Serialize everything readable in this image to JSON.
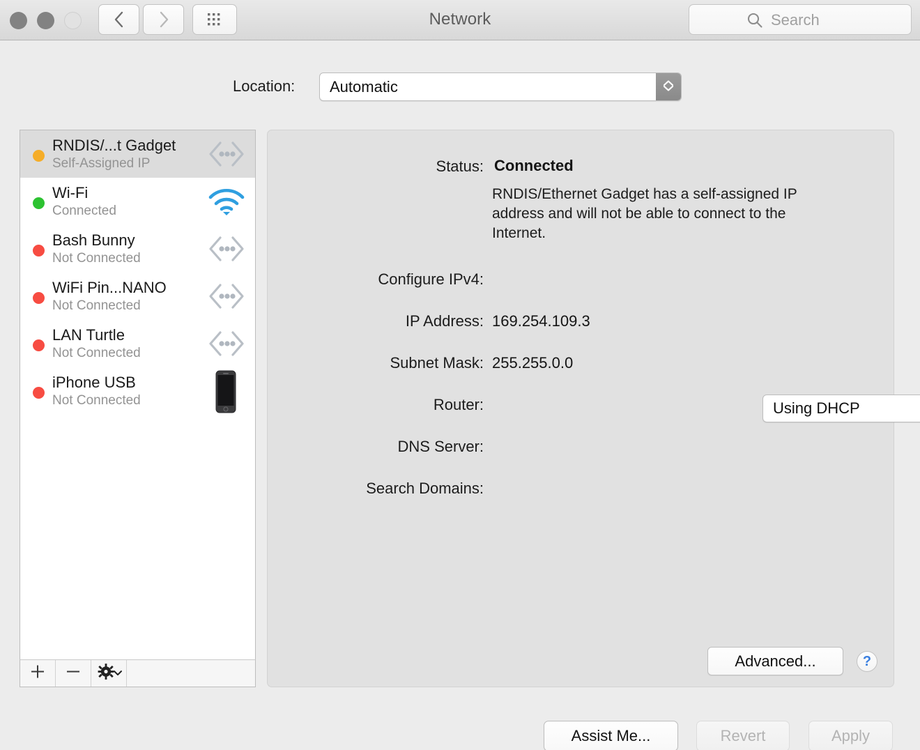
{
  "window": {
    "title": "Network",
    "traffic_lights": [
      "close",
      "minimize",
      "zoom"
    ]
  },
  "toolbar": {
    "back_icon": "chevron-left-icon",
    "forward_icon": "chevron-right-icon",
    "grid_icon": "show-all-grid-icon",
    "search": {
      "placeholder": "Search",
      "icon": "search-icon"
    }
  },
  "location": {
    "label": "Location:",
    "value": "Automatic"
  },
  "services": [
    {
      "name": "RNDIS/...t Gadget",
      "status": "Self-Assigned IP",
      "dot_color": "#f5ad28",
      "icon": "serial-ethernet-icon",
      "selected": true
    },
    {
      "name": "Wi-Fi",
      "status": "Connected",
      "dot_color": "#2cc231",
      "icon": "wifi-icon",
      "selected": false
    },
    {
      "name": "Bash Bunny",
      "status": "Not Connected",
      "dot_color": "#f74c42",
      "icon": "serial-ethernet-icon",
      "selected": false
    },
    {
      "name": "WiFi Pin...NANO",
      "status": "Not Connected",
      "dot_color": "#f74c42",
      "icon": "serial-ethernet-icon",
      "selected": false
    },
    {
      "name": "LAN Turtle",
      "status": "Not Connected",
      "dot_color": "#f74c42",
      "icon": "serial-ethernet-icon",
      "selected": false
    },
    {
      "name": "iPhone USB",
      "status": "Not Connected",
      "dot_color": "#f74c42",
      "icon": "iphone-icon",
      "selected": false
    }
  ],
  "list_toolbar": {
    "add_label": "+",
    "remove_label": "−",
    "action_icon": "gear-icon",
    "action_chevron": "chevron-down-icon"
  },
  "detail": {
    "status_label": "Status:",
    "status_value": "Connected",
    "status_note": "RNDIS/Ethernet Gadget has a self-assigned IP address and will not be able to connect to the Internet.",
    "configure_label": "Configure IPv4:",
    "configure_value": "Using DHCP",
    "ip_label": "IP Address:",
    "ip_value": "169.254.109.3",
    "subnet_label": "Subnet Mask:",
    "subnet_value": "255.255.0.0",
    "router_label": "Router:",
    "router_value": "",
    "dns_label": "DNS Server:",
    "dns_value": "",
    "search_domains_label": "Search Domains:",
    "search_domains_value": "",
    "advanced_label": "Advanced...",
    "help_label": "?"
  },
  "footer": {
    "assist_label": "Assist Me...",
    "revert_label": "Revert",
    "apply_label": "Apply"
  },
  "colors": {
    "accent_blue": "#3a7fe0",
    "status_green": "#2cc231",
    "status_amber": "#f5ad28",
    "status_red": "#f74c42"
  }
}
